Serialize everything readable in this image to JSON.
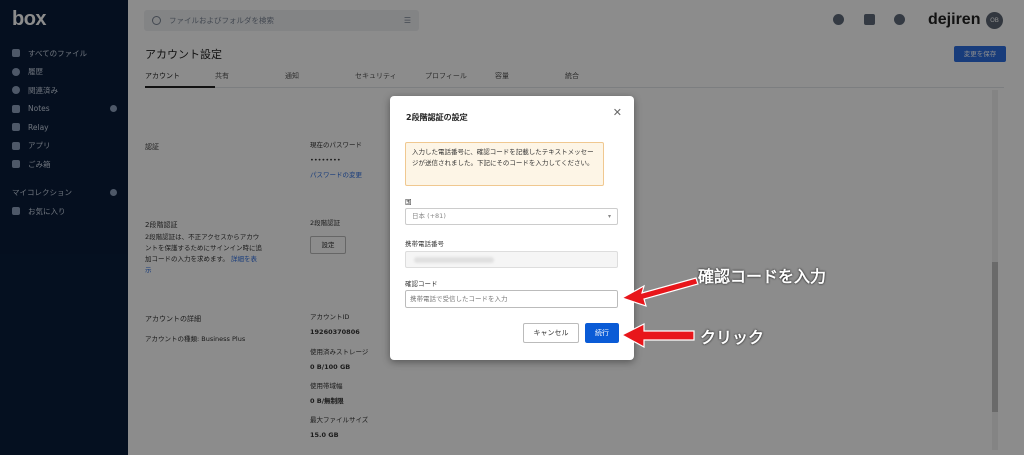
{
  "app": {
    "logo": "box",
    "brand": "dejiren",
    "avatar_initials": "OB"
  },
  "search": {
    "placeholder": "ファイルおよびフォルダを検索",
    "filter_icon": "filter-icon"
  },
  "sidebar": {
    "items": [
      {
        "label": "すべてのファイル",
        "icon": "folder-icon"
      },
      {
        "label": "履歴",
        "icon": "clock-icon"
      },
      {
        "label": "関連済み",
        "icon": "check-icon"
      },
      {
        "label": "Notes",
        "icon": "notes-icon"
      },
      {
        "label": "Relay",
        "icon": "relay-icon"
      },
      {
        "label": "アプリ",
        "icon": "apps-icon"
      },
      {
        "label": "ごみ箱",
        "icon": "trash-icon"
      }
    ],
    "collections_label": "マイコレクション",
    "favorites_label": "お気に入り"
  },
  "page": {
    "title": "アカウント設定",
    "save_button": "変更を保存",
    "tabs": [
      "アカウント",
      "共有",
      "通知",
      "セキュリティ",
      "プロフィール",
      "容量",
      "統合"
    ],
    "sections": {
      "auth_label": "認証",
      "current_password_label": "現在のパスワード",
      "password_dots": "••••••••",
      "change_password_link": "パスワードの変更",
      "twofa_label": "2段階認証",
      "twofa_desc": "2段階認証は、不正アクセスからアカウントを保護するためにサインイン時に追加コードの入力を求めます。",
      "twofa_more_link": "詳細を表示",
      "twofa_status_label": "2段階認証",
      "twofa_setup_button": "設定",
      "account_details_label": "アカウントの詳細",
      "account_type": "アカウントの種類: Business Plus",
      "account_id_label": "アカウントID",
      "account_id_value": "19260370806",
      "storage_used_label": "使用済みストレージ",
      "storage_used_value": "0 B/100 GB",
      "bandwidth_label": "使用帯域幅",
      "bandwidth_value": "0 B/無制限",
      "max_file_label": "最大ファイルサイズ",
      "max_file_value": "15.0 GB"
    }
  },
  "modal": {
    "title": "2段階認証の設定",
    "notice": "入力した電話番号に、確認コードを記載したテキストメッセージが送信されました。下記にそのコードを入力してください。",
    "country_label": "国",
    "country_value": "日本 (+81)",
    "phone_label": "携帯電話番号",
    "code_label": "確認コード",
    "code_placeholder": "携帯電話で受信したコードを入力",
    "cancel_button": "キャンセル",
    "continue_button": "続行"
  },
  "annotations": {
    "enter_code": "確認コードを入力",
    "click": "クリック",
    "arrow_color": "#e8161b"
  }
}
